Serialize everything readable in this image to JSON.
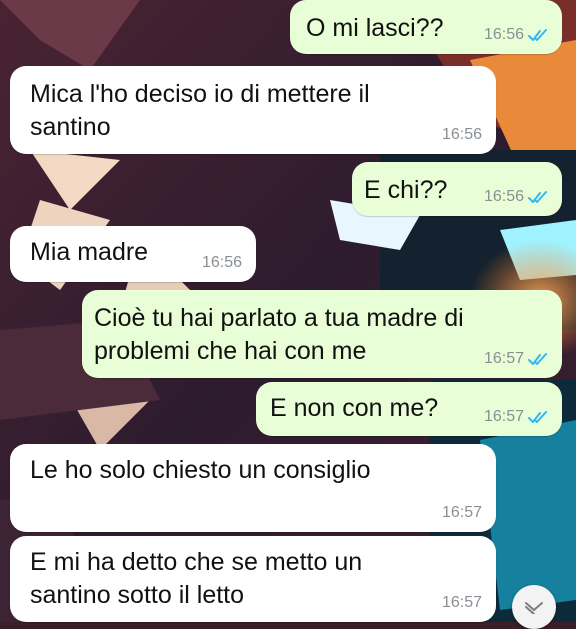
{
  "chat": {
    "messages": [
      {
        "dir": "out",
        "text": "O mi lasci??",
        "time": "16:56",
        "read": true
      },
      {
        "dir": "in",
        "text": "Mica l'ho deciso io di mettere il\nsantino",
        "time": "16:56"
      },
      {
        "dir": "out",
        "text": "E chi??",
        "time": "16:56",
        "read": true
      },
      {
        "dir": "in",
        "text": "Mia madre",
        "time": "16:56"
      },
      {
        "dir": "out",
        "text": "Cioè tu hai parlato a tua madre di\nproblemi che hai con me",
        "time": "16:57",
        "read": true
      },
      {
        "dir": "out",
        "text": "E non con me?",
        "time": "16:57",
        "read": true
      },
      {
        "dir": "in",
        "text": "Le ho solo chiesto un consiglio",
        "time": "16:57"
      },
      {
        "dir": "in",
        "text": "E mi ha detto che se metto un\nsantino sotto il letto",
        "time": "16:57"
      }
    ]
  },
  "colors": {
    "incoming": "#ffffff",
    "outgoing": "#e7fed6",
    "read_ticks": "#34b7f1",
    "time": "#8a8f94"
  },
  "icons": {
    "read_status": "double-check-icon",
    "scroll": "chevron-down-icon"
  }
}
